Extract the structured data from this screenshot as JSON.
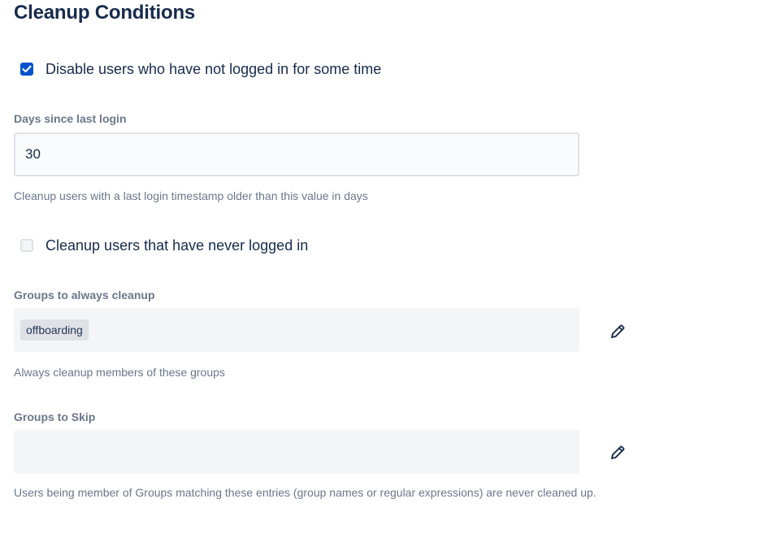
{
  "section": {
    "title": "Cleanup Conditions"
  },
  "disable_inactive": {
    "label": "Disable users who have not logged in for some time",
    "checked": true
  },
  "days_since_login": {
    "label": "Days since last login",
    "value": "30",
    "help": "Cleanup users with a last login timestamp older than this value in days"
  },
  "never_logged_in": {
    "label": "Cleanup users that have never logged in",
    "checked": false
  },
  "groups_always_cleanup": {
    "label": "Groups to always cleanup",
    "tags": [
      "offboarding"
    ],
    "help": "Always cleanup members of these groups",
    "edit_icon": "pencil-icon"
  },
  "groups_skip": {
    "label": "Groups to Skip",
    "tags": [],
    "help": "Users being member of Groups matching these entries (group names or regular expressions) are never cleaned up.",
    "edit_icon": "pencil-icon"
  },
  "colors": {
    "primary": "#0052cc",
    "text": "#172b4d",
    "subtle_text": "#6b778c",
    "field_bg": "#f4f5f7",
    "border": "#dfe1e6"
  }
}
